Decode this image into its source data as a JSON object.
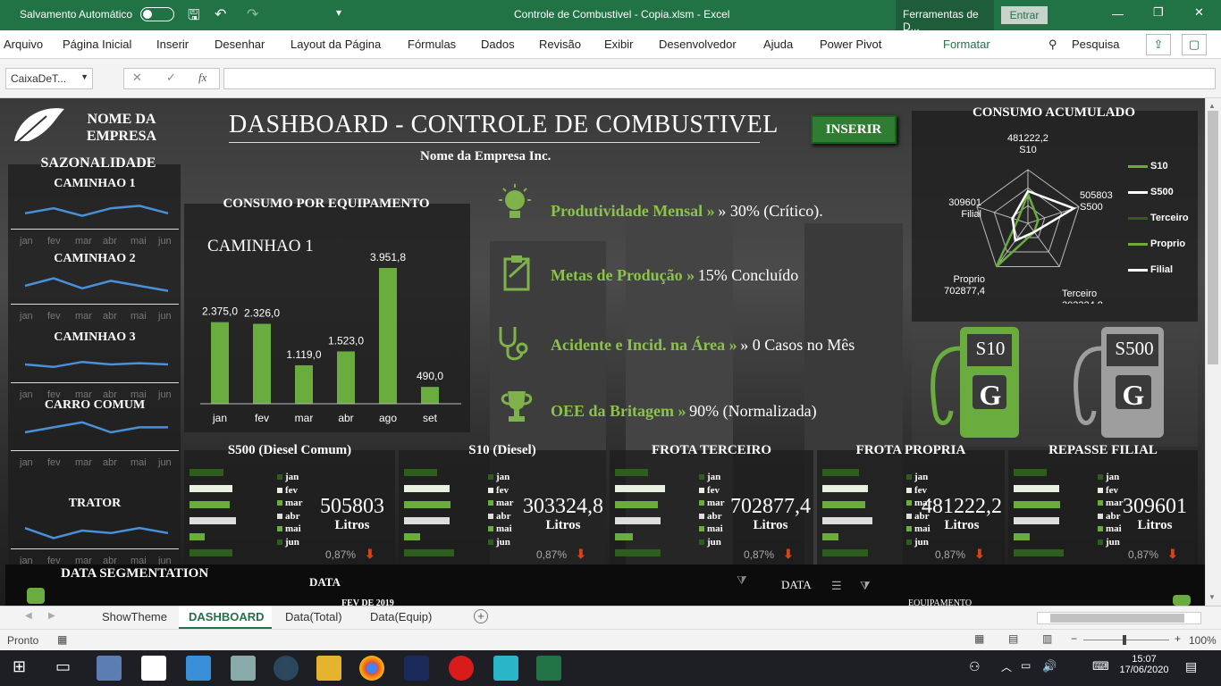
{
  "titlebar": {
    "autosave": "Salvamento Automático",
    "title": "Controle de Combustivel - Copia.xlsm  -  Excel",
    "tools": "Ferramentas de D...",
    "signin": "Entrar"
  },
  "ribbon": {
    "tabs": [
      "Arquivo",
      "Página Inicial",
      "Inserir",
      "Desenhar",
      "Layout da Página",
      "Fórmulas",
      "Dados",
      "Revisão",
      "Exibir",
      "Desenvolvedor",
      "Ajuda",
      "Power Pivot",
      "Formatar"
    ],
    "search": "Pesquisa"
  },
  "formula": {
    "namebox": "CaixaDeT...",
    "fx": "fx",
    "content": ""
  },
  "header": {
    "company_line1": "NOME DA",
    "company_line2": "EMPRESA",
    "title": "DASHBOARD - CONTROLE DE COMBUSTIVEL",
    "subtitle": "Nome da Empresa Inc.",
    "insert_button": "INSERIR"
  },
  "seasonality": {
    "title": "SAZONALIDADE",
    "months": [
      "jan",
      "fev",
      "mar",
      "abr",
      "mai",
      "jun"
    ],
    "items": [
      {
        "name": "CAMINHAO 1"
      },
      {
        "name": "CAMINHAO 2"
      },
      {
        "name": "CAMINHAO 3"
      },
      {
        "name": "CARRO COMUM"
      },
      {
        "name": "TRATOR"
      }
    ]
  },
  "equipment": {
    "title": "CONSUMO POR EQUIPAMENTO",
    "selected": "CAMINHAO 1"
  },
  "chart_data": {
    "type": "bar",
    "categories": [
      "jan",
      "fev",
      "mar",
      "abr",
      "ago",
      "set"
    ],
    "values": [
      2375.0,
      2326.0,
      1119.0,
      1523.0,
      3951.8,
      490.0
    ],
    "labels": [
      "2.375,0",
      "2.326,0",
      "1.119,0",
      "1.523,0",
      "3.951,8",
      "490,0"
    ],
    "color": "#6aac3e"
  },
  "kpis": [
    {
      "icon": "lightbulb-icon",
      "label": "Produtividade Mensal »",
      "value": "» 30% (Crítico)."
    },
    {
      "icon": "clipboard-icon",
      "label": "Metas de Produção »",
      "value": "15% Concluído"
    },
    {
      "icon": "stethoscope-icon",
      "label": "Acidente e Incid. na Área »",
      "value": "» 0 Casos no Mês"
    },
    {
      "icon": "trophy-icon",
      "label": "OEE da Britagem »",
      "value": "90% (Normalizada)"
    }
  ],
  "radar": {
    "title": "CONSUMO ACUMULADO",
    "axes": [
      {
        "name": "S10",
        "value": "481222,2"
      },
      {
        "name": "S500",
        "value": "505803"
      },
      {
        "name": "Terceiro",
        "value": "303324,8"
      },
      {
        "name": "Proprio",
        "value": "702877,4"
      },
      {
        "name": "Filial",
        "value": "309601"
      }
    ],
    "legend": [
      "S10",
      "S500",
      "Terceiro",
      "Proprio",
      "Filial"
    ]
  },
  "pumps": [
    {
      "label": "S10",
      "letter": "G",
      "color": "#6aac3e"
    },
    {
      "label": "S500",
      "letter": "G",
      "color": "#9e9e9e"
    }
  ],
  "fuel_cards": [
    {
      "title": "S500 (Diesel Comum)",
      "value": "505803",
      "unit": "Litros",
      "pct": "0,87%"
    },
    {
      "title": "S10 (Diesel)",
      "value": "303324,8",
      "unit": "Litros",
      "pct": "0,87%"
    },
    {
      "title": "FROTA TERCEIRO",
      "value": "702877,4",
      "unit": "Litros",
      "pct": "0,87%"
    },
    {
      "title": "FROTA PROPRIA",
      "value": "481222,2",
      "unit": "Litros",
      "pct": "0,87%"
    },
    {
      "title": "REPASSE FILIAL",
      "value": "309601",
      "unit": "Litros",
      "pct": "0,87%"
    }
  ],
  "card_months": [
    "jan",
    "fev",
    "mar",
    "abr",
    "mai",
    "jun"
  ],
  "segmentation": {
    "title": "DATA SEGMENTATION",
    "data_label": "DATA",
    "date_value": "FEV DE 2019",
    "data_label2": "DATA",
    "equip_label": "EQUIPAMENTO"
  },
  "sheet_tabs": [
    "ShowTheme",
    "DASHBOARD",
    "Data(Total)",
    "Data(Equip)"
  ],
  "status": {
    "ready": "Pronto",
    "zoom": "100%"
  },
  "clock": {
    "time": "15:07",
    "date": "17/06/2020"
  }
}
